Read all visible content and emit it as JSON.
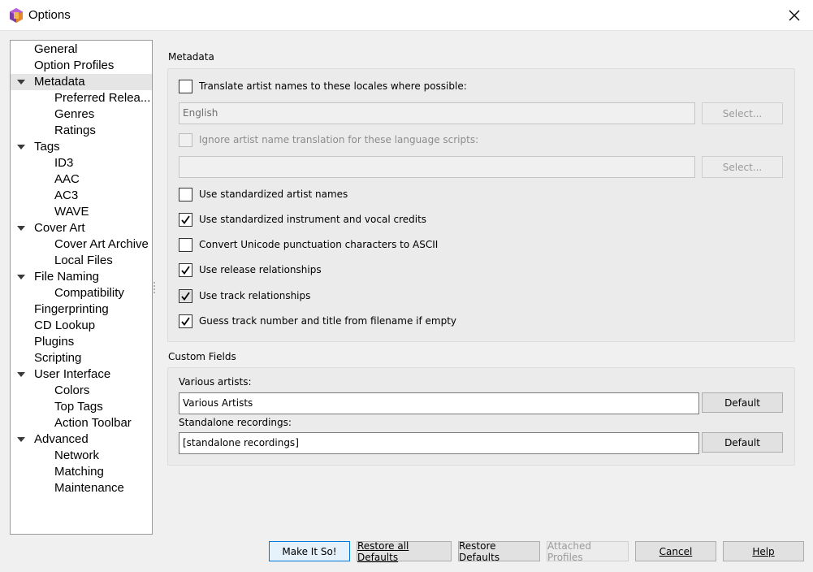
{
  "window": {
    "title": "Options"
  },
  "tree": {
    "items": [
      {
        "label": "General",
        "level": 0,
        "expanded": false,
        "selected": false
      },
      {
        "label": "Option Profiles",
        "level": 0,
        "expanded": false,
        "selected": false
      },
      {
        "label": "Metadata",
        "level": 0,
        "expanded": true,
        "selected": true
      },
      {
        "label": "Preferred Relea...",
        "level": 1,
        "expanded": false,
        "selected": false
      },
      {
        "label": "Genres",
        "level": 1,
        "expanded": false,
        "selected": false
      },
      {
        "label": "Ratings",
        "level": 1,
        "expanded": false,
        "selected": false
      },
      {
        "label": "Tags",
        "level": 0,
        "expanded": true,
        "selected": false
      },
      {
        "label": "ID3",
        "level": 1,
        "expanded": false,
        "selected": false
      },
      {
        "label": "AAC",
        "level": 1,
        "expanded": false,
        "selected": false
      },
      {
        "label": "AC3",
        "level": 1,
        "expanded": false,
        "selected": false
      },
      {
        "label": "WAVE",
        "level": 1,
        "expanded": false,
        "selected": false
      },
      {
        "label": "Cover Art",
        "level": 0,
        "expanded": true,
        "selected": false
      },
      {
        "label": "Cover Art Archive",
        "level": 1,
        "expanded": false,
        "selected": false
      },
      {
        "label": "Local Files",
        "level": 1,
        "expanded": false,
        "selected": false
      },
      {
        "label": "File Naming",
        "level": 0,
        "expanded": true,
        "selected": false
      },
      {
        "label": "Compatibility",
        "level": 1,
        "expanded": false,
        "selected": false
      },
      {
        "label": "Fingerprinting",
        "level": 0,
        "expanded": false,
        "selected": false
      },
      {
        "label": "CD Lookup",
        "level": 0,
        "expanded": false,
        "selected": false
      },
      {
        "label": "Plugins",
        "level": 0,
        "expanded": false,
        "selected": false
      },
      {
        "label": "Scripting",
        "level": 0,
        "expanded": false,
        "selected": false
      },
      {
        "label": "User Interface",
        "level": 0,
        "expanded": true,
        "selected": false
      },
      {
        "label": "Colors",
        "level": 1,
        "expanded": false,
        "selected": false
      },
      {
        "label": "Top Tags",
        "level": 1,
        "expanded": false,
        "selected": false
      },
      {
        "label": "Action Toolbar",
        "level": 1,
        "expanded": false,
        "selected": false
      },
      {
        "label": "Advanced",
        "level": 0,
        "expanded": true,
        "selected": false
      },
      {
        "label": "Network",
        "level": 1,
        "expanded": false,
        "selected": false
      },
      {
        "label": "Matching",
        "level": 1,
        "expanded": false,
        "selected": false
      },
      {
        "label": "Maintenance",
        "level": 1,
        "expanded": false,
        "selected": false
      }
    ]
  },
  "metadata": {
    "title": "Metadata",
    "translate_label": "Translate artist names to these locales where possible:",
    "translate_checked": false,
    "locales_value": "English",
    "locales_select": "Select...",
    "ignore_label": "Ignore artist name translation for these language scripts:",
    "ignore_checked": false,
    "scripts_value": "",
    "scripts_select": "Select...",
    "options": [
      {
        "label": "Use standardized artist names",
        "checked": false
      },
      {
        "label": "Use standardized instrument and vocal credits",
        "checked": true
      },
      {
        "label": "Convert Unicode punctuation characters to ASCII",
        "checked": false
      },
      {
        "label": "Use release relationships",
        "checked": true
      },
      {
        "label": "Use track relationships",
        "checked": true
      },
      {
        "label": "Guess track number and title from filename if empty",
        "checked": true
      }
    ]
  },
  "custom_fields": {
    "title": "Custom Fields",
    "various_label": "Various artists:",
    "various_value": "Various Artists",
    "various_default": "Default",
    "standalone_label": "Standalone recordings:",
    "standalone_value": "[standalone recordings]",
    "standalone_default": "Default"
  },
  "footer": {
    "make_it_so": "Make It So!",
    "restore_all": "Restore all Defaults",
    "restore": "Restore Defaults",
    "attached_profiles": "Attached Profiles",
    "cancel": "Cancel",
    "help": "Help"
  },
  "colors": {
    "accent": "#0078d7",
    "selected_bg": "#e5e5e5"
  }
}
